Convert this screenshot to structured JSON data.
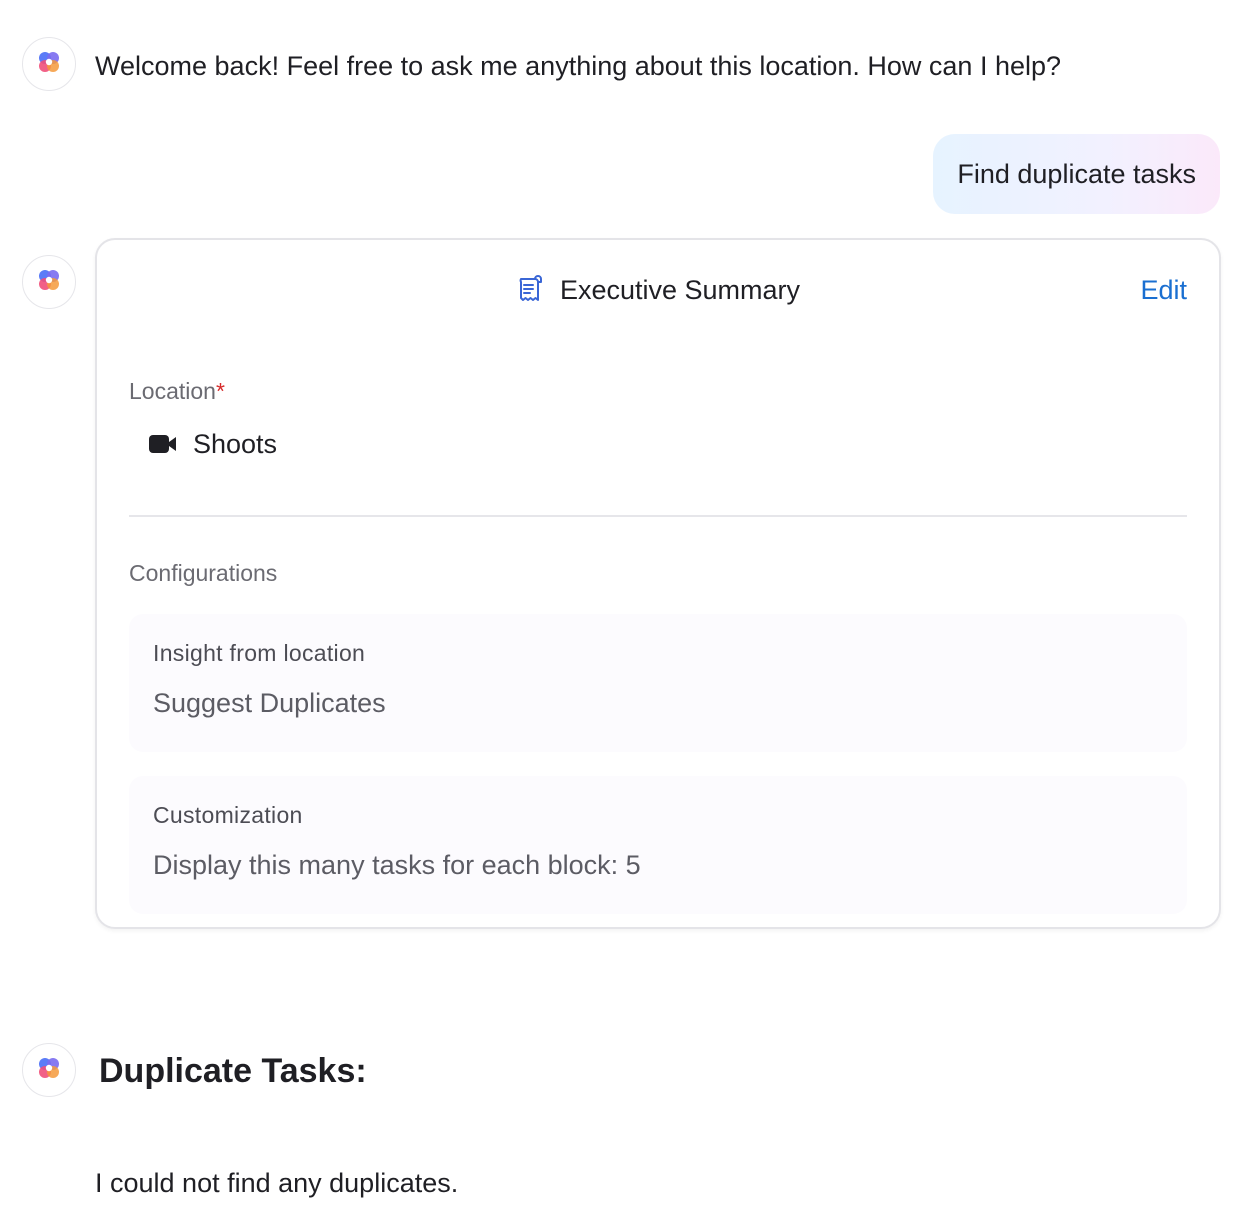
{
  "messages": {
    "welcome": "Welcome back! Feel free to ask me anything about this location. How can I help?",
    "user_prompt": "Find duplicate tasks"
  },
  "summary_card": {
    "icon": "receipt-scroll-icon",
    "title": "Executive Summary",
    "edit_label": "Edit",
    "location_label": "Location",
    "required_marker": "*",
    "location_icon": "video-camera-icon",
    "location_value": "Shoots",
    "configurations_label": "Configurations",
    "insight": {
      "label": "Insight from location",
      "value": "Suggest Duplicates"
    },
    "customization": {
      "label": "Customization",
      "value": "Display this many tasks for each block: 5"
    }
  },
  "result": {
    "title": "Duplicate Tasks:",
    "body": "I could not find any duplicates."
  },
  "colors": {
    "accent_link": "#1a6fd1",
    "required": "#d62a2a",
    "bubble_gradient_start": "#e6f3ff",
    "bubble_gradient_end": "#fbe9fa"
  }
}
